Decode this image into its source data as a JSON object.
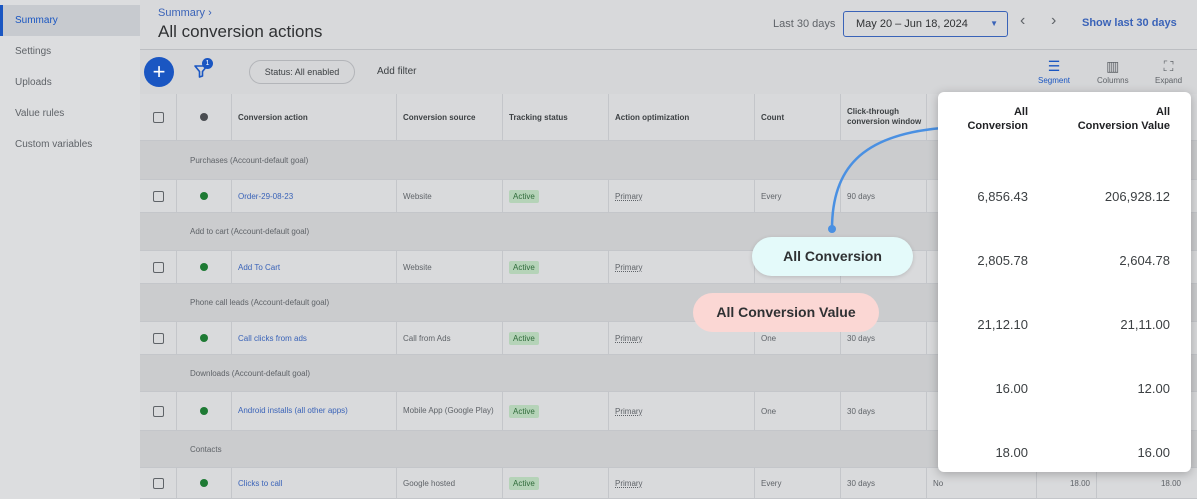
{
  "sidebar": {
    "items": [
      {
        "label": "Summary",
        "active": true
      },
      {
        "label": "Settings"
      },
      {
        "label": "Uploads"
      },
      {
        "label": "Value rules"
      },
      {
        "label": "Custom variables"
      }
    ]
  },
  "header": {
    "breadcrumb": "Summary",
    "title": "All conversion actions",
    "range_label": "Last 30 days",
    "date_range": "May 20 – Jun 18, 2024",
    "show_last": "Show last 30 days"
  },
  "toolbar": {
    "add_icon": "plus-icon",
    "filter_badge": "1",
    "status_chip": "Status: All enabled",
    "add_filter": "Add filter",
    "segment": "Segment",
    "columns": "Columns",
    "expand": "Expand"
  },
  "table": {
    "headers": {
      "action": "Conversion action",
      "source": "Conversion source",
      "tracking": "Tracking status",
      "optimization": "Action optimization",
      "count": "Count",
      "window": "Click-through conversion window"
    },
    "groups": [
      {
        "label": "Purchases (Account-default goal)",
        "row": {
          "action": "Order-29-08-23",
          "source": "Website",
          "status": "Active",
          "optimization": "Primary",
          "count": "Every",
          "window": "90 days"
        }
      },
      {
        "label": "Add to cart (Account-default goal)",
        "row": {
          "action": "Add To Cart",
          "source": "Website",
          "status": "Active",
          "optimization": "Primary",
          "count": "",
          "window": ""
        }
      },
      {
        "label": "Phone call leads (Account-default goal)",
        "row": {
          "action": "Call clicks from ads",
          "source": "Call from Ads",
          "status": "Active",
          "optimization": "Primary",
          "count": "One",
          "window": "30 days"
        }
      },
      {
        "label": "Downloads (Account-default goal)",
        "row": {
          "action": "Android installs (all other apps)",
          "source": "Mobile App (Google Play)",
          "status": "Active",
          "optimization": "Primary",
          "count": "One",
          "window": "30 days"
        }
      },
      {
        "label": "Contacts",
        "row": {
          "action": "Clicks to call",
          "source": "Google hosted",
          "status": "Active",
          "optimization": "Primary",
          "count": "Every",
          "window": "30 days",
          "extra": "No",
          "val1": "18.00",
          "val2": "18.00"
        }
      }
    ]
  },
  "popup": {
    "col1_header": [
      "All",
      "Conversion"
    ],
    "col2_header": [
      "All",
      "Conversion Value"
    ],
    "values": [
      [
        "6,856.43",
        "206,928.12"
      ],
      [
        "2,805.78",
        "2,604.78"
      ],
      [
        "21,12.10",
        "21,11.00"
      ],
      [
        "16.00",
        "12.00"
      ],
      [
        "18.00",
        "16.00"
      ]
    ]
  },
  "callouts": {
    "conversion": "All Conversion",
    "value": "All Conversion Value"
  },
  "colors": {
    "accent": "#1a56c2",
    "active_badge": "#b5d3b8",
    "callout_conversion": "#e4fafa",
    "callout_value": "#fbd7d4",
    "connector": "#4a90e2"
  }
}
